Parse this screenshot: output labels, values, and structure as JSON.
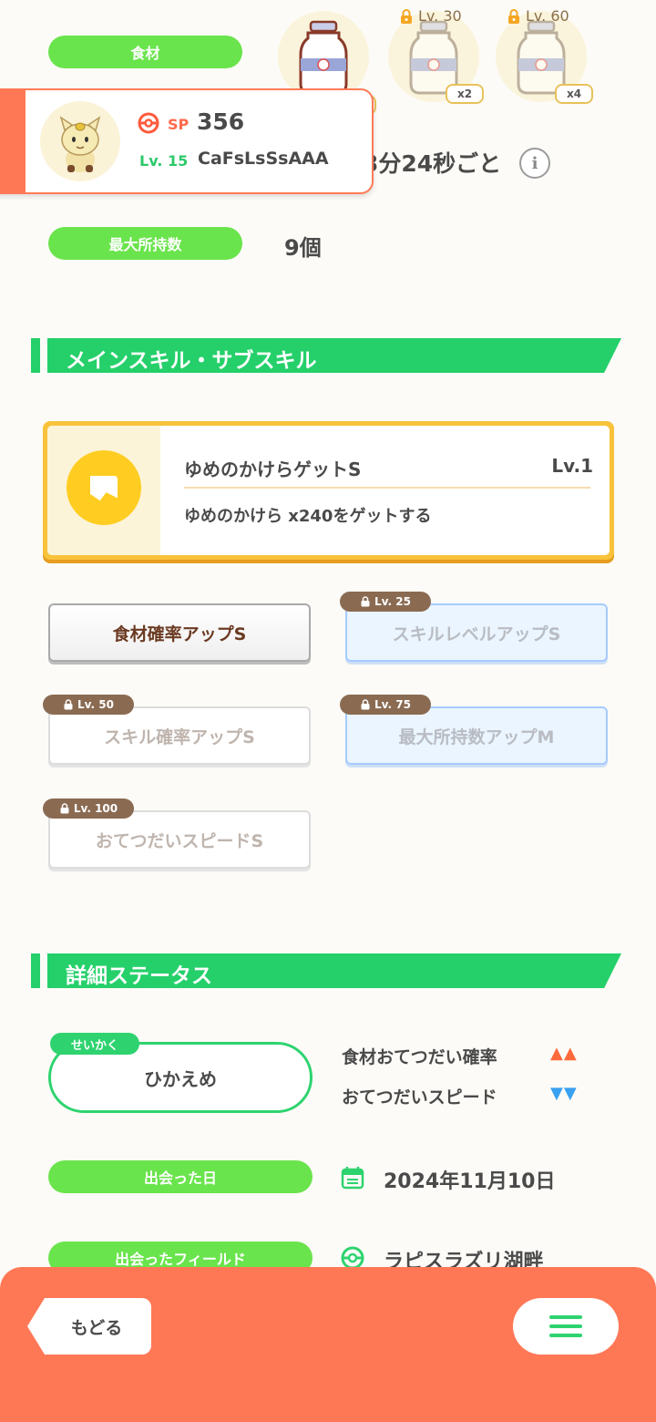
{
  "ingredients": {
    "label": "食材",
    "locks": [
      "Lv. 30",
      "Lv. 60"
    ],
    "multipliers": [
      "x2",
      "x4"
    ]
  },
  "pokemon": {
    "sp_label": "SP",
    "sp_value": "356",
    "level": "Lv. 15",
    "name": "CaFsLsSsAAA"
  },
  "help_time": "3分24秒ごと",
  "max_carry": {
    "label": "最大所持数",
    "value": "9個"
  },
  "skills_section": {
    "title": "メインスキル・サブスキル",
    "main_skill": {
      "name": "ゆめのかけらゲットS",
      "level": "Lv.1",
      "description": "ゆめのかけら x240をゲットする"
    },
    "sub_skills": [
      {
        "name": "食材確率アップS",
        "lock": ""
      },
      {
        "name": "スキルレベルアップS",
        "lock": "Lv. 25"
      },
      {
        "name": "スキル確率アップS",
        "lock": "Lv. 50"
      },
      {
        "name": "最大所持数アップM",
        "lock": "Lv. 75"
      },
      {
        "name": "おてつだいスピードS",
        "lock": "Lv. 100"
      }
    ]
  },
  "details_section": {
    "title": "詳細ステータス",
    "nature_tag": "せいかく",
    "nature": "ひかえめ",
    "effects": [
      {
        "label": "食材おてつだい確率",
        "arrows": "▲▲",
        "color": "#ff6a3d"
      },
      {
        "label": "おてつだいスピード",
        "arrows": "▼▼",
        "color": "#3aa0f0"
      }
    ],
    "met_date_label": "出会った日",
    "met_date": "2024年11月10日",
    "met_field_label": "出会ったフィールド",
    "met_field": "ラピスラズリ湖畔"
  },
  "nav": {
    "back": "もどる"
  },
  "colors": {
    "accent_green": "#25d06a",
    "pill_green": "#6ae44c",
    "bottom_bar": "#ff7856",
    "skill_gold": "#f8c23a"
  }
}
